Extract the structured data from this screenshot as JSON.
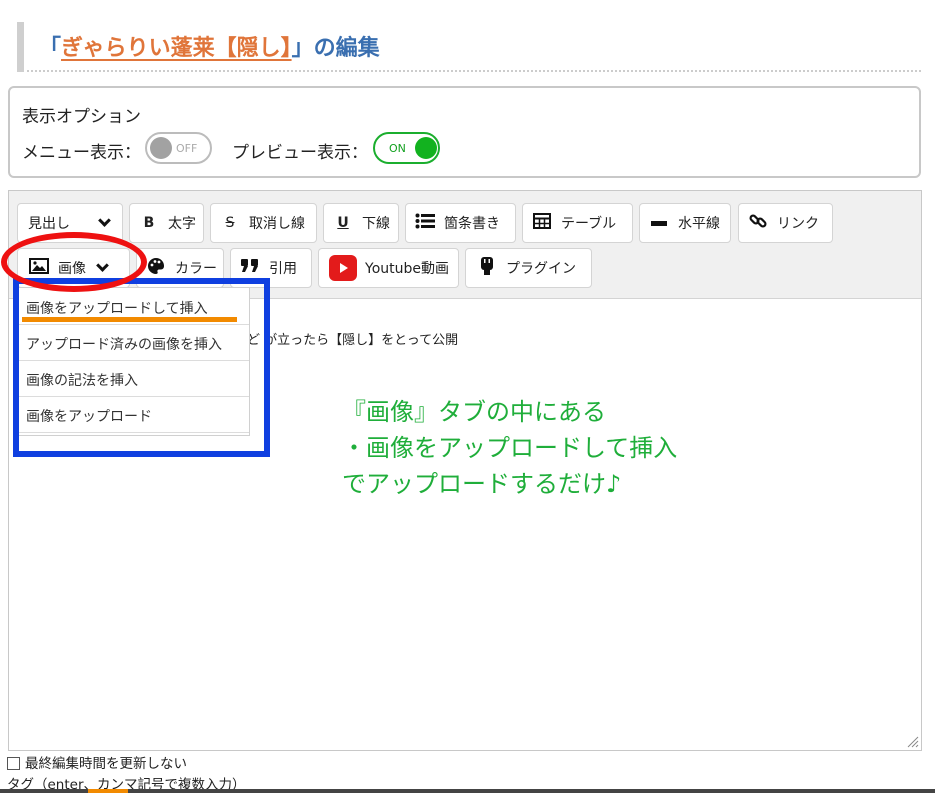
{
  "page": {
    "title_open": "「",
    "title_link": "ぎゃらりい蓬莱【隠し】",
    "title_close": "」の編集"
  },
  "display_options": {
    "title": "表示オプション",
    "menu_label": "メニュー表示：",
    "menu_toggle": "OFF",
    "preview_label": "プレビュー表示：",
    "preview_toggle": "ON",
    "colors": {
      "toggle_on": "#12b21f",
      "toggle_off": "#a2a2a2"
    }
  },
  "toolbar": {
    "heading": "見出し",
    "bold": "太字",
    "strike": "取消し線",
    "underline": "下線",
    "bullets": "箇条書き",
    "table": "テーブル",
    "hr": "水平線",
    "link": "リンク",
    "image": "画像",
    "color": "カラー",
    "quote": "引用",
    "youtube": "Youtube動画",
    "plugin": "プラグイン",
    "icons": {
      "bold": "B",
      "strike": "S",
      "underline": "U"
    }
  },
  "image_menu": {
    "items": [
      {
        "label": "画像をアップロードして挿入"
      },
      {
        "label": "アップロード済みの画像を挿入"
      },
      {
        "label": "画像の記法を挿入"
      },
      {
        "label": "画像をアップロード"
      }
    ]
  },
  "editor": {
    "visible_text": "ど が立ったら【隠し】をとって公開"
  },
  "annotation": {
    "line1": "『画像』タブの中にある",
    "line2": "・画像をアップロードして挿入",
    "line3": "でアップロードするだけ♪",
    "color": "#1fae3a"
  },
  "footer": {
    "checkbox_label": "最終編集時間を更新しない",
    "tags_label": "タグ（enter、カンマ記号で複数入力）"
  }
}
